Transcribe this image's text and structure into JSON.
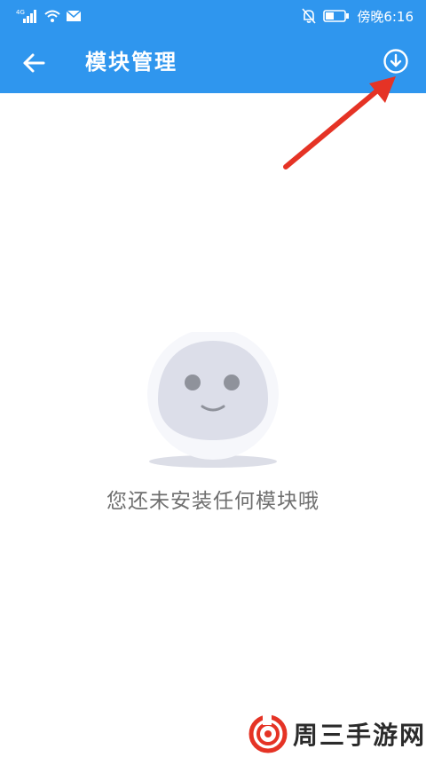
{
  "status_bar": {
    "network_label": "4G",
    "time_text": "傍晚6:16",
    "icons": [
      "signal-icon",
      "wifi-icon",
      "mail-icon",
      "mute-bell-icon",
      "battery-icon"
    ]
  },
  "app_bar": {
    "title": "模块管理",
    "back_icon": "arrow-left-icon",
    "download_icon": "download-circle-icon"
  },
  "empty_state": {
    "illustration": "smiley-face-icon",
    "message": "您还未安装任何模块哦"
  },
  "watermark": {
    "text": "周三手游网",
    "logo": "swirl-logo-icon"
  },
  "colors": {
    "primary": "#2f96ee",
    "annotation_arrow": "#e53325",
    "message_text": "#6f6f6f"
  }
}
